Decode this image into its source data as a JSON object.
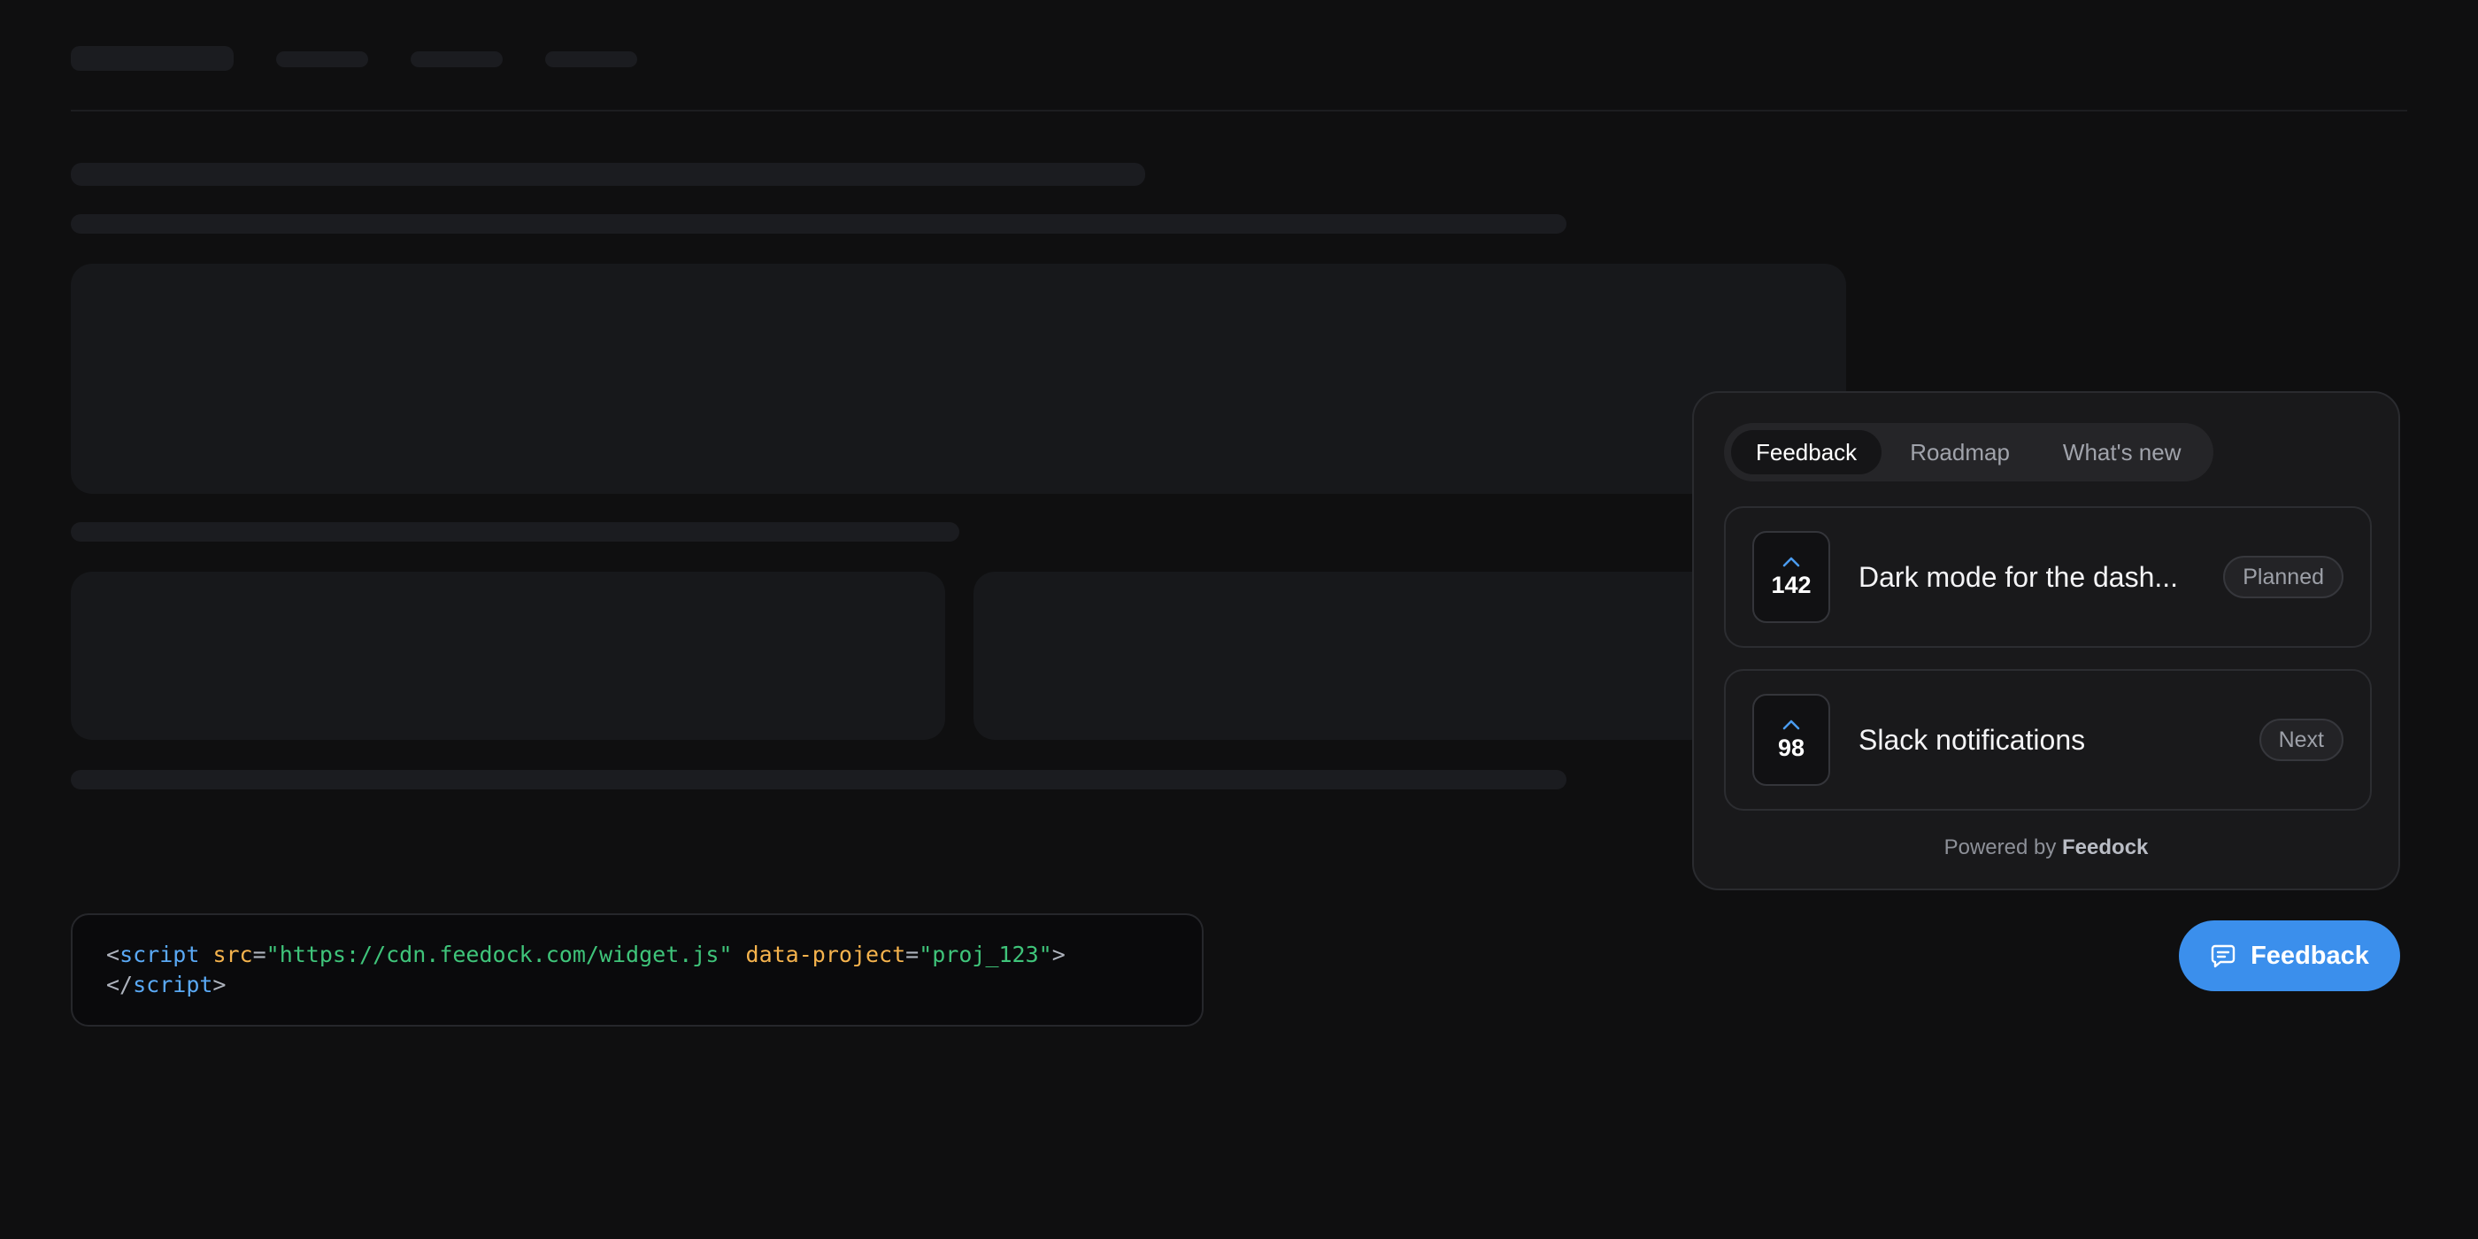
{
  "embed_code": {
    "open_bracket": "<",
    "tag": "script",
    "attr_src": "src",
    "equals": "=",
    "src_value": "\"https://cdn.feedock.com/widget.js\"",
    "attr_project": "data-project",
    "project_value": "\"proj_123\"",
    "close_bracket": ">",
    "closing_open": "</",
    "closing_tag": "script",
    "closing_close": ">"
  },
  "widget": {
    "tabs": [
      {
        "label": "Feedback",
        "active": true
      },
      {
        "label": "Roadmap",
        "active": false
      },
      {
        "label": "What's new",
        "active": false
      }
    ],
    "items": [
      {
        "votes": "142",
        "title": "Dark mode for the dash...",
        "status": "Planned",
        "icon": "chevron-up-icon"
      },
      {
        "votes": "98",
        "title": "Slack notifications",
        "status": "Next",
        "icon": "chevron-up-icon"
      }
    ],
    "powered_prefix": "Powered by",
    "powered_brand": "Feedock"
  },
  "launcher": {
    "label": "Feedback",
    "icon": "chat-bubble-icon"
  },
  "colors": {
    "background": "#0f0f10",
    "accent": "#3b8fec",
    "panel": "#19191b",
    "code_tag": "#5aa9f5",
    "code_attr": "#f5b34d",
    "code_string": "#3fc47a"
  }
}
